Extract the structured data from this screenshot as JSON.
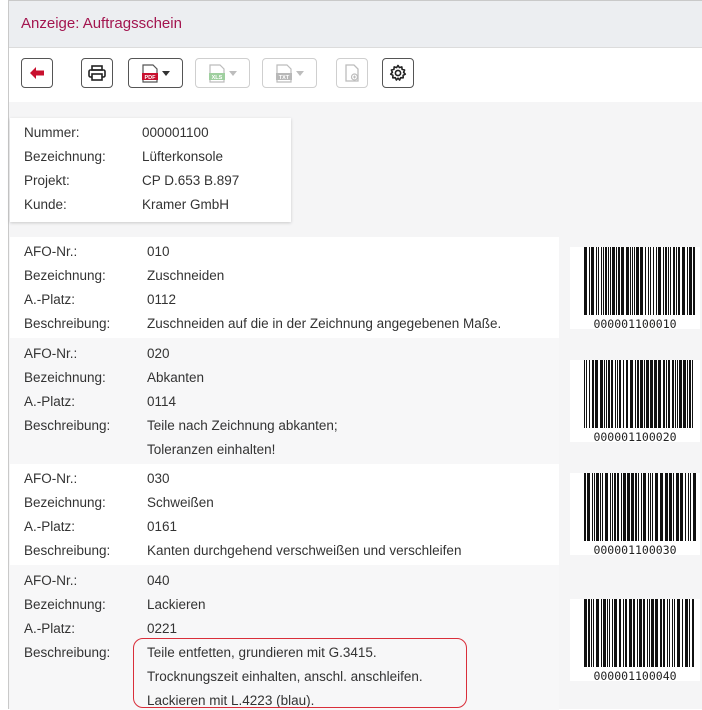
{
  "window": {
    "title": "Anzeige: Auftragsschein"
  },
  "toolbar": {
    "back_icon": "arrow-left-icon",
    "print_icon": "printer-icon",
    "pdf_icon": "pdf-icon",
    "pdf_label": "PDF",
    "xls_icon": "xls-icon",
    "xls_label": "XLS",
    "txt_icon": "txt-icon",
    "txt_label": "TXT",
    "doc_icon": "document-add-icon",
    "settings_icon": "gear-icon"
  },
  "header": {
    "rows": [
      {
        "label": "Nummer:",
        "value": "000001100"
      },
      {
        "label": "Bezeichnung:",
        "value": "Lüfterkonsole"
      },
      {
        "label": "Projekt:",
        "value": "CP D.653 B.897"
      },
      {
        "label": "Kunde:",
        "value": "Kramer GmbH"
      }
    ]
  },
  "labels": {
    "afo": "AFO-Nr.:",
    "bezeichnung": "Bezeichnung:",
    "platz": "A.-Platz:",
    "beschreibung": "Beschreibung:"
  },
  "operations": [
    {
      "afo": "010",
      "bezeichnung": "Zuschneiden",
      "platz": "0112",
      "beschreibung": [
        "Zuschneiden auf die in der Zeichnung angegebenen Maße."
      ],
      "barcode": "000001100010"
    },
    {
      "afo": "020",
      "bezeichnung": "Abkanten",
      "platz": "0114",
      "beschreibung": [
        "Teile nach Zeichnung abkanten;",
        "Toleranzen einhalten!"
      ],
      "barcode": "000001100020"
    },
    {
      "afo": "030",
      "bezeichnung": "Schweißen",
      "platz": "0161",
      "beschreibung": [
        "Kanten durchgehend verschweißen und verschleifen"
      ],
      "barcode": "000001100030"
    },
    {
      "afo": "040",
      "bezeichnung": "Lackieren",
      "platz": "0221",
      "beschreibung": [
        "Teile entfetten, grundieren mit G.3415.",
        "Trocknungszeit einhalten, anschl. anschleifen.",
        "Lackieren mit L.4223 (blau)."
      ],
      "barcode": "000001100040"
    }
  ],
  "colors": {
    "accent": "#a3154f",
    "highlight": "#d92e3a",
    "pdf": "#c8102e"
  }
}
